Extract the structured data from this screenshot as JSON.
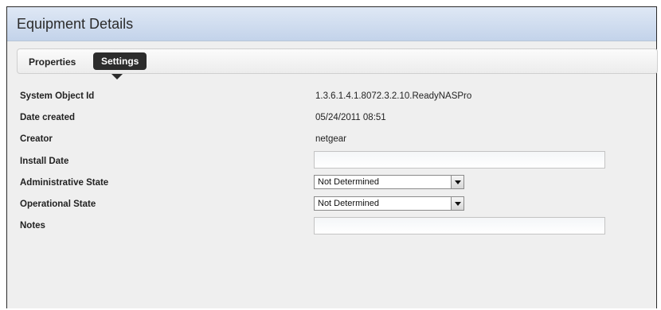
{
  "header": {
    "title": "Equipment Details"
  },
  "tabs": [
    {
      "label": "Properties"
    },
    {
      "label": "Settings"
    }
  ],
  "fields": {
    "system_object_id": {
      "label": "System Object Id",
      "value": "1.3.6.1.4.1.8072.3.2.10.ReadyNASPro"
    },
    "date_created": {
      "label": "Date created",
      "value": "05/24/2011 08:51"
    },
    "creator": {
      "label": "Creator",
      "value": "netgear"
    },
    "install_date": {
      "label": "Install Date",
      "value": ""
    },
    "administrative_state": {
      "label": "Administrative State",
      "value": "Not Determined"
    },
    "operational_state": {
      "label": "Operational State",
      "value": "Not Determined"
    },
    "notes": {
      "label": "Notes",
      "value": ""
    }
  }
}
